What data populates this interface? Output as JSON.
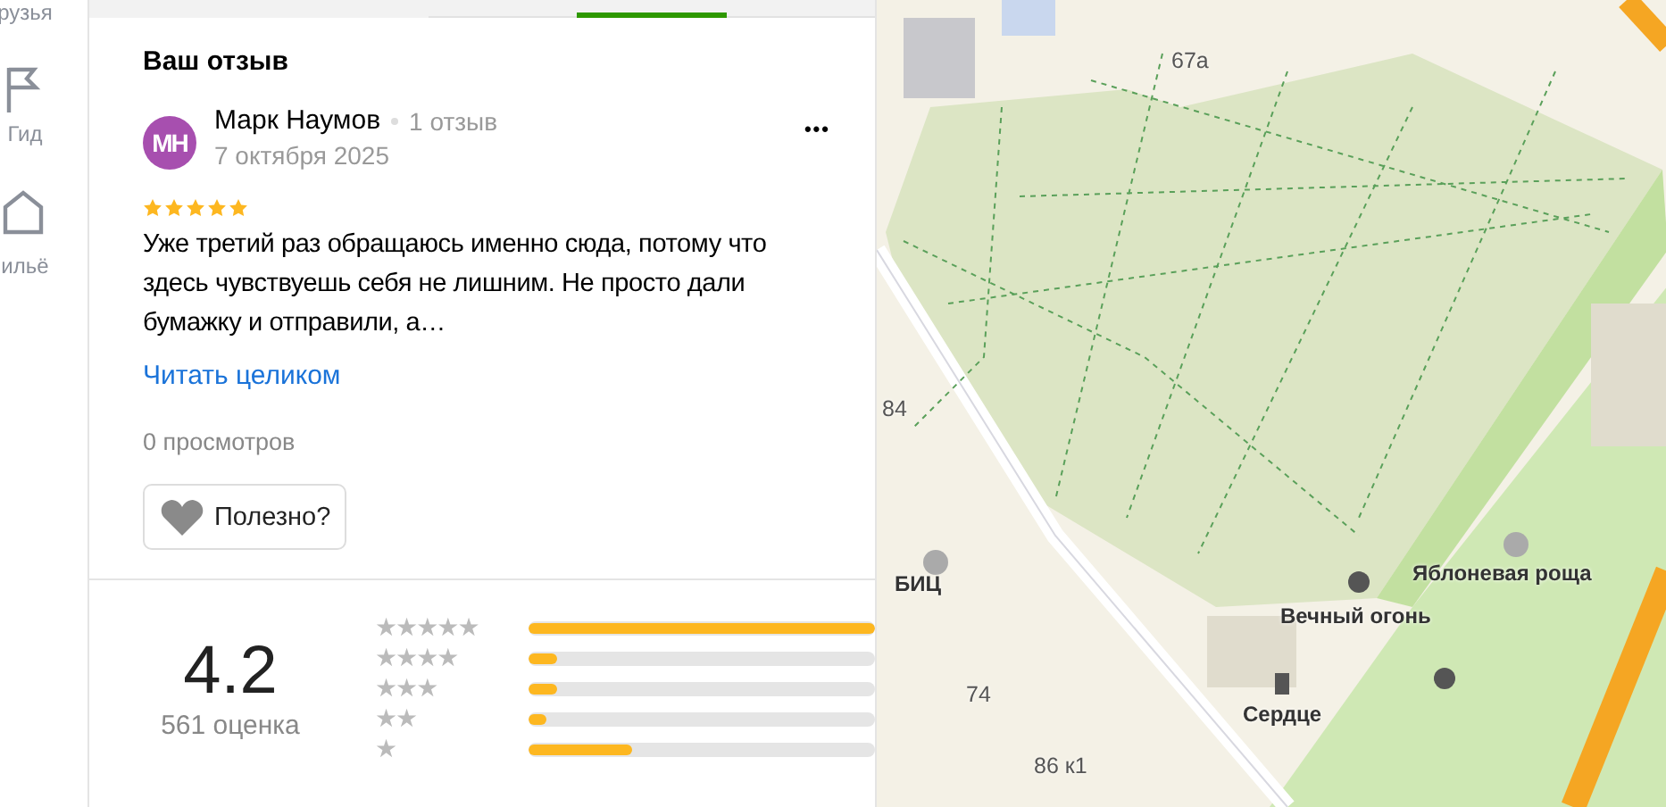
{
  "sidebar": {
    "items": [
      {
        "label": "рузья",
        "kind": "friends"
      },
      {
        "label": "Гид",
        "kind": "guide"
      },
      {
        "label": "ильё",
        "kind": "housing"
      }
    ]
  },
  "tabs": [
    {
      "selected": false
    },
    {
      "selected": true
    },
    {
      "selected": false
    }
  ],
  "review_section": {
    "title": "Ваш отзыв",
    "author": {
      "initials": "МН",
      "name": "Марк Наумов",
      "reviews_count": "1 отзыв",
      "date": "7 октября 2025"
    },
    "more": "•••",
    "stars": 5,
    "text": "Уже третий раз обращаюсь именно сюда, потому что здесь чувствуешь себя не лишним. Не просто дали бумажку и отправили, а…",
    "read_more": "Читать целиком",
    "views": "0 просмотров",
    "useful_button": "Полезно?"
  },
  "rating_summary": {
    "score": "4.2",
    "count": "561 оценка",
    "distribution": [
      {
        "label": "★★★★★",
        "level": 1.0
      },
      {
        "label": "★★★★",
        "level": 0.08
      },
      {
        "label": "★★★",
        "level": 0.08
      },
      {
        "label": "★★",
        "level": 0.05
      },
      {
        "label": "★",
        "level": 0.3
      }
    ]
  },
  "map": {
    "labels": [
      {
        "text": "67а",
        "kind": "house"
      },
      {
        "text": "84",
        "kind": "house"
      },
      {
        "text": "БИЦ",
        "kind": "place"
      },
      {
        "text": "74",
        "kind": "house"
      },
      {
        "text": "86 к1",
        "kind": "house"
      },
      {
        "text": "Сердце",
        "kind": "place"
      },
      {
        "text": "Вечный огонь",
        "kind": "place"
      },
      {
        "text": "Яблоневая роща",
        "kind": "place"
      }
    ]
  }
}
